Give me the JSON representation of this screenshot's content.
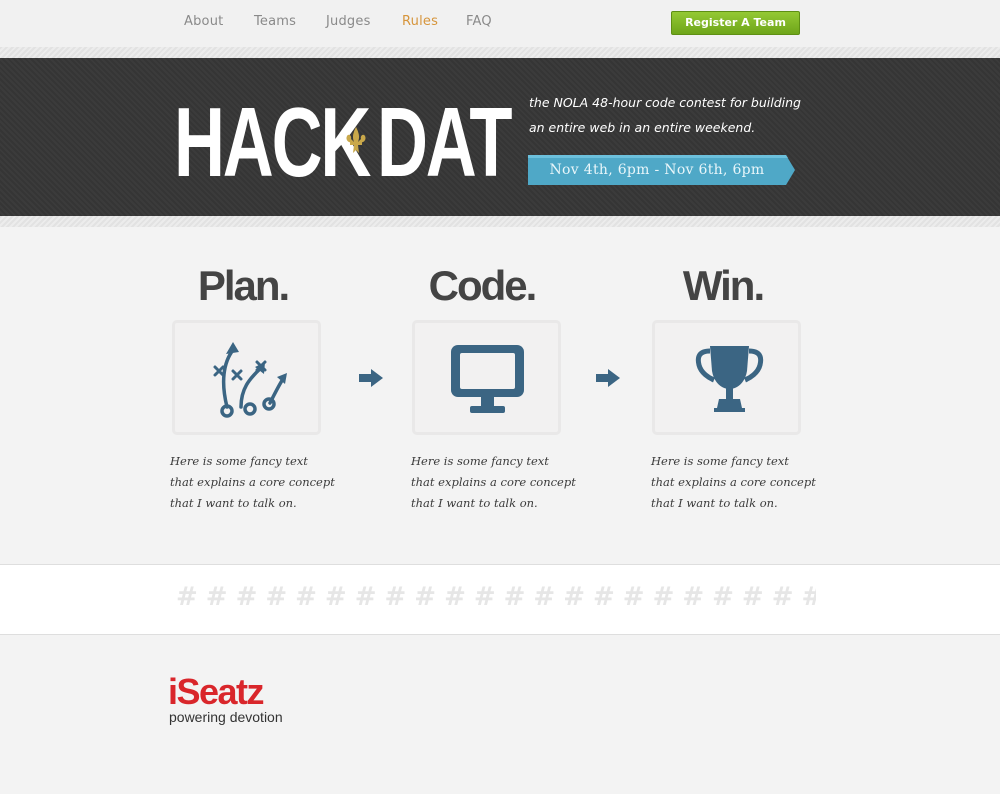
{
  "nav": {
    "items": [
      {
        "label": "About",
        "active": false
      },
      {
        "label": "Teams",
        "active": false
      },
      {
        "label": "Judges",
        "active": false
      },
      {
        "label": "Rules",
        "active": true
      },
      {
        "label": "FAQ",
        "active": false
      }
    ],
    "register_label": "Register A Team"
  },
  "hero": {
    "logo_left": "HACK",
    "logo_right": "DAT",
    "tagline": "the NOLA 48-hour code contest for building an entire web in an entire weekend.",
    "dates": "Nov 4th, 6pm - Nov 6th, 6pm",
    "fleur_icon": "fleur-de-lis-icon"
  },
  "steps": [
    {
      "title": "Plan.",
      "icon": "playbook-icon",
      "text": "Here is some fancy text that explains a core concept that I want to talk on."
    },
    {
      "title": "Code.",
      "icon": "monitor-icon",
      "text": "Here is some fancy text that explains a core concept that I want to talk on."
    },
    {
      "title": "Win.",
      "icon": "trophy-icon",
      "text": "Here is some fancy text that explains a core concept that I want to talk on."
    }
  ],
  "divider": {
    "hashes": "#########################"
  },
  "sponsor": {
    "name": "iSeatz",
    "tagline": "powering devotion"
  },
  "colors": {
    "accent_blue": "#3b6583",
    "nav_active": "#d6953c",
    "register_green": "#7cb323",
    "sponsor_red": "#d9262b",
    "ribbon": "#4fa8c7"
  }
}
